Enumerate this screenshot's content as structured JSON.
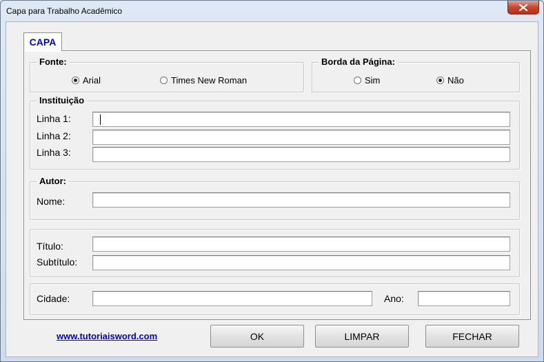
{
  "window": {
    "title": "Capa para Trabalho Acadêmico",
    "close_icon": "close-icon"
  },
  "tab": {
    "label": "CAPA"
  },
  "fonte": {
    "title": "Fonte:",
    "options": [
      {
        "label": "Arial",
        "selected": true
      },
      {
        "label": "Times New Roman",
        "selected": false
      }
    ]
  },
  "borda": {
    "title": "Borda da Página:",
    "options": [
      {
        "label": "Sim",
        "selected": false
      },
      {
        "label": "Não",
        "selected": true
      }
    ]
  },
  "instituicao": {
    "title": "Instituição",
    "linha1_label": "Linha 1:",
    "linha1_value": "",
    "linha2_label": "Linha 2:",
    "linha2_value": "",
    "linha3_label": "Linha 3:",
    "linha3_value": ""
  },
  "autor": {
    "title": "Autor:",
    "nome_label": "Nome:",
    "nome_value": ""
  },
  "trabalho": {
    "titulo_label": "Título:",
    "titulo_value": "",
    "subtitulo_label": "Subtítulo:",
    "subtitulo_value": ""
  },
  "local": {
    "cidade_label": "Cidade:",
    "cidade_value": "",
    "ano_label": "Ano:",
    "ano_value": ""
  },
  "footer": {
    "link": "www.tutoriaisword.com",
    "ok": "OK",
    "limpar": "LIMPAR",
    "fechar": "FECHAR"
  }
}
